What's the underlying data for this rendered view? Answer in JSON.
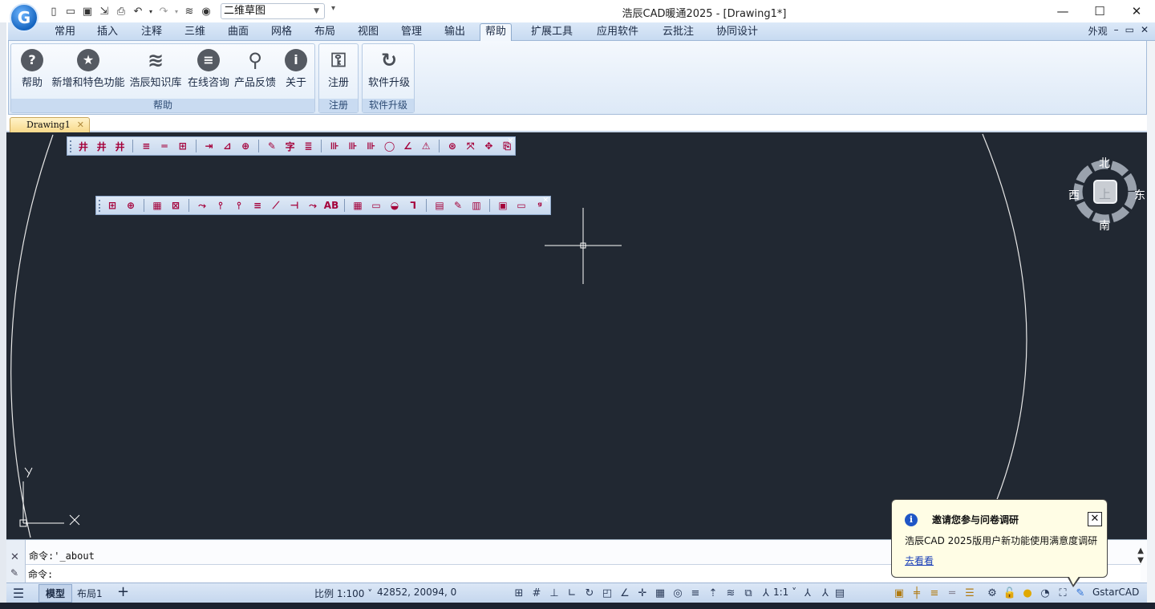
{
  "window": {
    "title": "浩辰CAD暖通2025 - [Drawing1*]",
    "logo_letter": "G",
    "minimize": "—",
    "maximize": "☐",
    "close": "✕"
  },
  "quick_access": {
    "workspace": "二维草图",
    "more": "▾"
  },
  "ribbon": {
    "tabs": [
      "常用",
      "插入",
      "注释",
      "三维",
      "曲面",
      "网格",
      "布局",
      "视图",
      "管理",
      "输出",
      "帮助",
      "扩展工具",
      "应用软件",
      "云批注",
      "协同设计"
    ],
    "active_tab": "帮助",
    "appearance": "外观",
    "groups": [
      {
        "label": "帮助",
        "buttons": [
          {
            "label": "帮助",
            "icon": "?"
          },
          {
            "label": "新增和特色功能",
            "icon": "★"
          },
          {
            "label": "浩辰知识库",
            "icon": "≋"
          },
          {
            "label": "在线咨询",
            "icon": "≡"
          },
          {
            "label": "产品反馈",
            "icon": "⚲"
          },
          {
            "label": "关于",
            "icon": "i"
          }
        ]
      },
      {
        "label": "注册",
        "buttons": [
          {
            "label": "注册",
            "icon": "⚿"
          }
        ]
      },
      {
        "label": "软件升级",
        "buttons": [
          {
            "label": "软件升级",
            "icon": "↻"
          }
        ]
      }
    ]
  },
  "document": {
    "tab_label": "Drawing1"
  },
  "toolbar1": {
    "icons": [
      "井",
      "井",
      "井",
      "|",
      "≡",
      "═",
      "⊞",
      "|",
      "⇥",
      "⊿",
      "⊕",
      "|",
      "✎",
      "字",
      "≣",
      "|",
      "⊪",
      "⊪",
      "⊪",
      "◯",
      "∠",
      "⚠",
      "|",
      "⊛",
      "⤧",
      "✥",
      "⎘"
    ]
  },
  "toolbar2": {
    "icons": [
      "⊞",
      "⊕",
      "|",
      "▦",
      "⊠",
      "|",
      "⤳",
      "⫯",
      "⫯",
      "≡",
      "⟋",
      "⊣",
      "⤳",
      "AB",
      "|",
      "▦",
      "▭",
      "◒",
      "⅂",
      "|",
      "▤",
      "✎",
      "▥",
      "|",
      "▣",
      "▭",
      "ᵍ"
    ]
  },
  "viewcube": {
    "north": "北",
    "south": "南",
    "east": "东",
    "west": "西",
    "top": "上"
  },
  "command": {
    "history": "命令:'_about",
    "prompt": "命令:"
  },
  "statusbar": {
    "model_tab": "模型",
    "layout_tab": "布局1",
    "add_tab": "+",
    "scale": "比例 1:100 ˅",
    "coordinates": "42852, 20094, 0",
    "annotation_scale": "1:1 ˅",
    "product": "GstarCAD"
  },
  "survey": {
    "title": "邀请您参与问卷调研",
    "body": "浩辰CAD 2025版用户新功能使用满意度调研",
    "link": "去看看",
    "close": "✕"
  },
  "colors": {
    "canvas_bg": "#212832",
    "ribbon_bg": "#dde9f7",
    "accent": "#1f56c6"
  }
}
